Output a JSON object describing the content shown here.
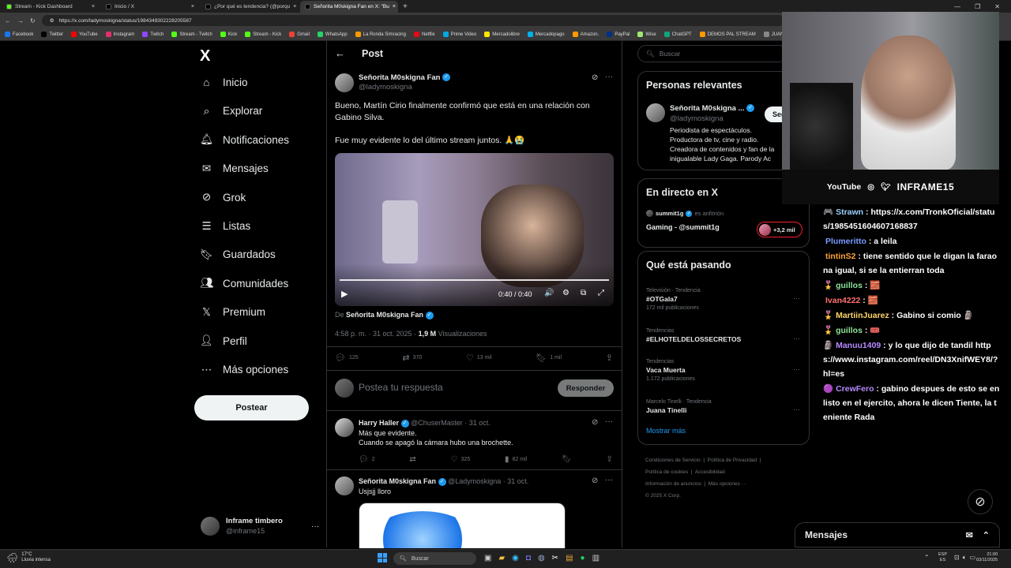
{
  "browser": {
    "tabs": [
      {
        "label": "Stream - Kick Dashboard",
        "color": "#53fc18",
        "active": false
      },
      {
        "label": "Inicio / X",
        "color": "#000000",
        "active": false
      },
      {
        "label": "¿Por qué es tendencia? (@porqu",
        "color": "#000000",
        "active": false
      },
      {
        "label": "Señorita M0skigna Fan en X: \"Bu",
        "color": "#000000",
        "active": true
      }
    ],
    "new_tab": "+",
    "url": "https://x.com/ladymoskigna/status/1984349302228205587",
    "bookmarks": [
      "Facebook",
      "Twitter",
      "YouTube",
      "Instagram",
      "Twitch",
      "Stream - Twitch",
      "Kick",
      "Stream - Kick",
      "Gmail",
      "WhatsApp",
      "La Ronda Simracing",
      "Netflix",
      "Prime Video",
      "Mercadolibre",
      "Mercadopago",
      "Amazon.",
      "PayPal",
      "Wise",
      "ChatGPT",
      "DEMOS PAL STREAM",
      "JUAN TUR"
    ]
  },
  "nav": {
    "logo": "X",
    "items": [
      {
        "label": "Inicio",
        "icon": "home-icon"
      },
      {
        "label": "Explorar",
        "icon": "search-icon"
      },
      {
        "label": "Notificaciones",
        "icon": "bell-icon"
      },
      {
        "label": "Mensajes",
        "icon": "mail-icon"
      },
      {
        "label": "Grok",
        "icon": "grok-icon"
      },
      {
        "label": "Listas",
        "icon": "list-icon"
      },
      {
        "label": "Guardados",
        "icon": "bookmark-icon"
      },
      {
        "label": "Comunidades",
        "icon": "communities-icon"
      },
      {
        "label": "Premium",
        "icon": "x-icon"
      },
      {
        "label": "Perfil",
        "icon": "person-icon"
      },
      {
        "label": "Más opciones",
        "icon": "more-icon"
      }
    ],
    "post_button": "Postear",
    "profile": {
      "name": "Inframe timbero",
      "handle": "@inframe15",
      "more": "···"
    }
  },
  "post": {
    "header_title": "Post",
    "author": "Señorita M0skigna Fan",
    "handle": "@ladymoskigna",
    "text1": "Bueno, Martín Cirio finalmente confirmó que está en una relación con Gabino Silva.",
    "text2": "Fue muy evidente lo del último stream juntos. 🙏😭",
    "video_time": "0:40 / 0:40",
    "from_prefix": "De",
    "from_author": "Señorita M0skigna Fan",
    "timestamp": "4:58 p. m. · 31 oct. 2025 ·",
    "views_count": "1,9 M",
    "views_label": "Visualizaciones",
    "stats": {
      "replies": "125",
      "reposts": "370",
      "likes": "13 mil",
      "bookmarks": "1 mil"
    },
    "reply_placeholder": "Postea tu respuesta",
    "reply_button": "Responder"
  },
  "replies": [
    {
      "author": "Harry Haller",
      "handle": "@ChuserMaster",
      "date": "· 31 oct.",
      "line1": "Más que evidente.",
      "line2": "Cuando se apagó la cámara hubo una brochette.",
      "replies": "2",
      "likes": "325",
      "views": "82 mil"
    },
    {
      "author": "Señorita M0skigna Fan",
      "handle": "@Ladymoskigna",
      "date": "· 31 oct.",
      "line1": "Usjsjj lloro"
    }
  ],
  "right": {
    "search_placeholder": "Buscar",
    "relevant_title": "Personas relevantes",
    "relevant": {
      "name": "Señorita M0skigna ...",
      "handle": "@ladymoskigna",
      "follow": "Seguir",
      "bio": [
        "Periodista de espectáculos.",
        "Productora de tv, cine y radio.",
        "Creadora de contenidos y fan de la",
        "inigualable Lady Gaga. Parody Ac"
      ]
    },
    "live_title": "En directo en X",
    "live": {
      "host": "summit1g",
      "host_label": "es anfitrión",
      "title": "Gaming - @summit1g",
      "count": "+3,2 mil"
    },
    "trends_title": "Qué está pasando",
    "trends": [
      {
        "context": "Televisión · Tendencia",
        "title": "#OTGala7",
        "count": "172 mil publicaciones"
      },
      {
        "context": "Tendencias",
        "title": "#ELHOTELDELOSSECRETOS",
        "count": ""
      },
      {
        "context": "Tendencias",
        "title": "Vaca Muerta",
        "count": "1.172 publicaciones"
      },
      {
        "context": "Marcelo Tinelli · Tendencia",
        "title": "Juana Tinelli",
        "count": ""
      }
    ],
    "show_more": "Mostrar más",
    "footer": [
      "Condiciones de Servicio",
      "Política de Privacidad",
      "Política de cookies",
      "Accesibilidad",
      "Información de anuncios",
      "Más opciones ···",
      "© 2025 X Corp."
    ]
  },
  "overlay": {
    "socials": [
      "YouTube",
      "INFRAME15"
    ],
    "chat": [
      {
        "user": "Strawn",
        "color": "#9bd1ff",
        "msg": "https://x.com/TronkOficial/status/1985451604607168837",
        "badge": "🎮"
      },
      {
        "user": "Plumeritto",
        "color": "#7b9bff",
        "msg": "a leila",
        "badge": ""
      },
      {
        "user": "tintinS2",
        "color": "#ffa53a",
        "msg": "tiene sentido que le digan la faraona igual, si se la entierran toda",
        "badge": ""
      },
      {
        "user": "guillos",
        "color": "#8fe39a",
        "msg": "🧱",
        "badge": "🎖️"
      },
      {
        "user": "Ivan4222",
        "color": "#ff7070",
        "msg": "🧱",
        "badge": ""
      },
      {
        "user": "MartiinJuarez",
        "color": "#ffd56b",
        "msg": "Gabino si comio 🗿",
        "badge": "🎖️"
      },
      {
        "user": "guillos",
        "color": "#8fe39a",
        "msg": "🎟️",
        "badge": "🎖️"
      },
      {
        "user": "Manuu1409",
        "color": "#b78bff",
        "msg": "y lo que dijo de tandil https://www.instagram.com/reel/DN3XnifWEY8/?hl=es",
        "badge": "🗿"
      },
      {
        "user": "CrewFero",
        "color": "#b78bff",
        "msg": "gabino despues de esto se enlisto en el ejercito, ahora le dicen Tiente, la teniente Rada",
        "badge": "🟣"
      }
    ]
  },
  "messages_bar": {
    "label": "Mensajes"
  },
  "taskbar": {
    "weather_temp": "17°C",
    "weather_desc": "Lluvia intensa",
    "search": "Buscar",
    "lang1": "ESP",
    "lang2": "ES",
    "time": "21:00",
    "date": "03/11/2025"
  },
  "colors": {
    "accent": "#1d9bf0",
    "bg": "#000000",
    "border": "#2f3336",
    "muted": "#71767b"
  }
}
